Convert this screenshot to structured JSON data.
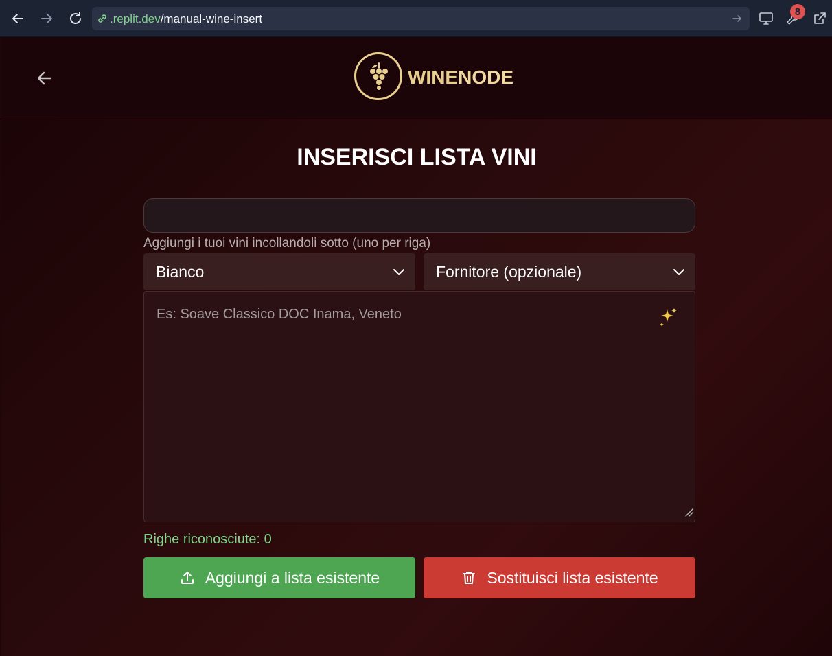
{
  "browser": {
    "url_domain": ".replit.dev",
    "url_path": "/manual-wine-insert",
    "notification_count": "8"
  },
  "header": {
    "logo_wine": "WINE",
    "logo_node": "NODE"
  },
  "page": {
    "title": "INSERISCI LISTA VINI",
    "name_input_value": "",
    "helper_text": "Aggiungi i tuoi vini incollandoli sotto (uno per riga)",
    "type_select": "Bianco",
    "supplier_select": "Fornitore (opzionale)",
    "textarea_placeholder": "Es: Soave Classico DOC Inama, Veneto",
    "recognized_rows": "Righe riconosciute: 0",
    "add_button": "Aggiungi a lista esistente",
    "replace_button": "Sostituisci lista esistente"
  },
  "colors": {
    "accent_gold": "#e9cf8f",
    "add_green": "#4ea653",
    "replace_red": "#cc3a34",
    "counter_green": "#7fd58a"
  }
}
